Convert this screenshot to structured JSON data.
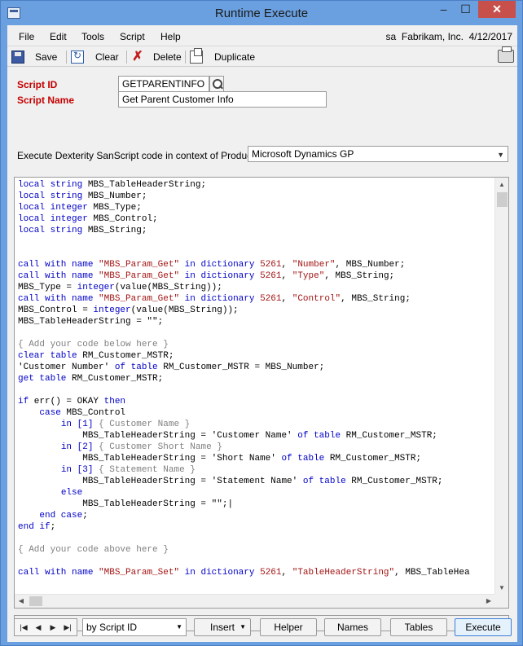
{
  "window": {
    "title": "Runtime Execute",
    "minimize_label": "‒",
    "maximize_label": "☐",
    "close_label": "✕"
  },
  "menubar": {
    "items": [
      "File",
      "Edit",
      "Tools",
      "Script",
      "Help"
    ],
    "user": "sa",
    "company": "Fabrikam, Inc.",
    "date": "4/12/2017"
  },
  "toolbar": {
    "save_label": "Save",
    "clear_label": "Clear",
    "delete_label": "Delete",
    "duplicate_label": "Duplicate"
  },
  "form": {
    "script_id_label": "Script ID",
    "script_id_value": "GETPARENTINFO",
    "script_name_label": "Script Name",
    "script_name_value": "Get Parent Customer Info",
    "product_label": "Execute Dexterity SanScript code in context of Product:",
    "product_value": "Microsoft Dynamics GP"
  },
  "code_lines": [
    [
      [
        "kw",
        "local string"
      ],
      [
        "t",
        " MBS_TableHeaderString;"
      ]
    ],
    [
      [
        "kw",
        "local string"
      ],
      [
        "t",
        " MBS_Number;"
      ]
    ],
    [
      [
        "kw",
        "local integer"
      ],
      [
        "t",
        " MBS_Type;"
      ]
    ],
    [
      [
        "kw",
        "local integer"
      ],
      [
        "t",
        " MBS_Control;"
      ]
    ],
    [
      [
        "kw",
        "local string"
      ],
      [
        "t",
        " MBS_String;"
      ]
    ],
    [],
    [],
    [
      [
        "kw",
        "call with name"
      ],
      [
        "t",
        " "
      ],
      [
        "str",
        "\"MBS_Param_Get\""
      ],
      [
        "t",
        " "
      ],
      [
        "kw",
        "in dictionary"
      ],
      [
        "t",
        " "
      ],
      [
        "num",
        "5261"
      ],
      [
        "t",
        ", "
      ],
      [
        "str",
        "\"Number\""
      ],
      [
        "t",
        ", MBS_Number;"
      ]
    ],
    [
      [
        "kw",
        "call with name"
      ],
      [
        "t",
        " "
      ],
      [
        "str",
        "\"MBS_Param_Get\""
      ],
      [
        "t",
        " "
      ],
      [
        "kw",
        "in dictionary"
      ],
      [
        "t",
        " "
      ],
      [
        "num",
        "5261"
      ],
      [
        "t",
        ", "
      ],
      [
        "str",
        "\"Type\""
      ],
      [
        "t",
        ", MBS_String;"
      ]
    ],
    [
      [
        "t",
        "MBS_Type = "
      ],
      [
        "kw",
        "integer"
      ],
      [
        "t",
        "(value(MBS_String));"
      ]
    ],
    [
      [
        "kw",
        "call with name"
      ],
      [
        "t",
        " "
      ],
      [
        "str",
        "\"MBS_Param_Get\""
      ],
      [
        "t",
        " "
      ],
      [
        "kw",
        "in dictionary"
      ],
      [
        "t",
        " "
      ],
      [
        "num",
        "5261"
      ],
      [
        "t",
        ", "
      ],
      [
        "str",
        "\"Control\""
      ],
      [
        "t",
        ", MBS_String;"
      ]
    ],
    [
      [
        "t",
        "MBS_Control = "
      ],
      [
        "kw",
        "integer"
      ],
      [
        "t",
        "(value(MBS_String));"
      ]
    ],
    [
      [
        "t",
        "MBS_TableHeaderString = \"\";"
      ]
    ],
    [],
    [
      [
        "cmt",
        "{ Add your code below here }"
      ]
    ],
    [
      [
        "kw",
        "clear table"
      ],
      [
        "t",
        " RM_Customer_MSTR;"
      ]
    ],
    [
      [
        "t",
        "'Customer Number' "
      ],
      [
        "kw",
        "of table"
      ],
      [
        "t",
        " RM_Customer_MSTR = MBS_Number;"
      ]
    ],
    [
      [
        "kw",
        "get table"
      ],
      [
        "t",
        " RM_Customer_MSTR;"
      ]
    ],
    [],
    [
      [
        "kw",
        "if"
      ],
      [
        "t",
        " err() = OKAY "
      ],
      [
        "kw",
        "then"
      ]
    ],
    [
      [
        "t",
        "    "
      ],
      [
        "kw",
        "case"
      ],
      [
        "t",
        " MBS_Control"
      ]
    ],
    [
      [
        "t",
        "        "
      ],
      [
        "kw",
        "in"
      ],
      [
        "t",
        " "
      ],
      [
        "kw",
        "[1]"
      ],
      [
        "t",
        " "
      ],
      [
        "cmt",
        "{ Customer Name }"
      ]
    ],
    [
      [
        "t",
        "            MBS_TableHeaderString = 'Customer Name' "
      ],
      [
        "kw",
        "of table"
      ],
      [
        "t",
        " RM_Customer_MSTR;"
      ]
    ],
    [
      [
        "t",
        "        "
      ],
      [
        "kw",
        "in"
      ],
      [
        "t",
        " "
      ],
      [
        "kw",
        "[2]"
      ],
      [
        "t",
        " "
      ],
      [
        "cmt",
        "{ Customer Short Name }"
      ]
    ],
    [
      [
        "t",
        "            MBS_TableHeaderString = 'Short Name' "
      ],
      [
        "kw",
        "of table"
      ],
      [
        "t",
        " RM_Customer_MSTR;"
      ]
    ],
    [
      [
        "t",
        "        "
      ],
      [
        "kw",
        "in"
      ],
      [
        "t",
        " "
      ],
      [
        "kw",
        "[3]"
      ],
      [
        "t",
        " "
      ],
      [
        "cmt",
        "{ Statement Name }"
      ]
    ],
    [
      [
        "t",
        "            MBS_TableHeaderString = 'Statement Name' "
      ],
      [
        "kw",
        "of table"
      ],
      [
        "t",
        " RM_Customer_MSTR;"
      ]
    ],
    [
      [
        "t",
        "        "
      ],
      [
        "kw",
        "else"
      ]
    ],
    [
      [
        "t",
        "            MBS_TableHeaderString = \"\";|"
      ]
    ],
    [
      [
        "t",
        "    "
      ],
      [
        "kw",
        "end case"
      ],
      [
        "t",
        ";"
      ]
    ],
    [
      [
        "kw",
        "end if"
      ],
      [
        "t",
        ";"
      ]
    ],
    [],
    [
      [
        "cmt",
        "{ Add your code above here }"
      ]
    ],
    [],
    [
      [
        "kw",
        "call with name"
      ],
      [
        "t",
        " "
      ],
      [
        "str",
        "\"MBS_Param_Set\""
      ],
      [
        "t",
        " "
      ],
      [
        "kw",
        "in dictionary"
      ],
      [
        "t",
        " "
      ],
      [
        "num",
        "5261"
      ],
      [
        "t",
        ", "
      ],
      [
        "str",
        "\"TableHeaderString\""
      ],
      [
        "t",
        ", MBS_TableHea"
      ]
    ]
  ],
  "bottom": {
    "sort_value": "by Script ID",
    "insert_label": "Insert",
    "helper_label": "Helper",
    "names_label": "Names",
    "tables_label": "Tables",
    "execute_label": "Execute"
  },
  "colors": {
    "title_bar": "#6aa0df",
    "required_label": "#c40000",
    "keyword": "#0000c8",
    "string": "#a31515",
    "comment": "#808080"
  }
}
